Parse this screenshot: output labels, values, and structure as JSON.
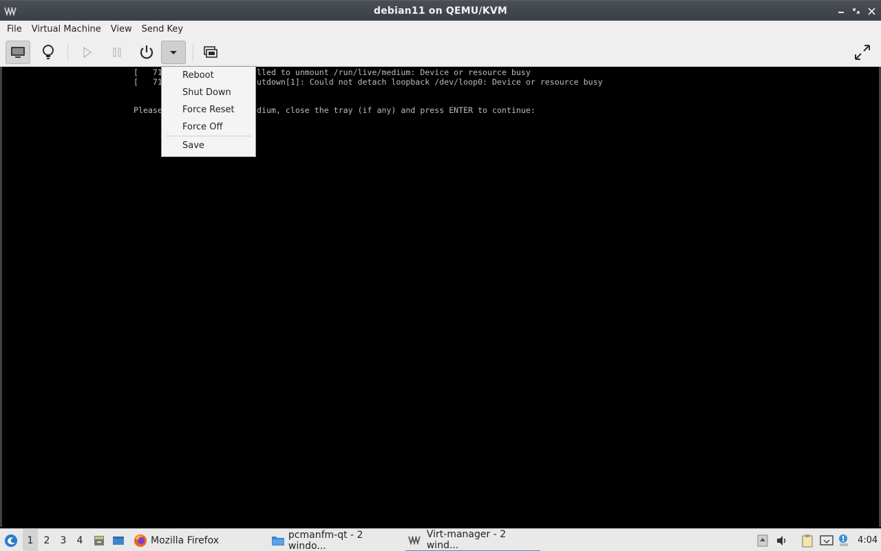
{
  "window": {
    "title": "debian11 on QEMU/KVM",
    "controls": [
      "minimize",
      "restore",
      "close"
    ]
  },
  "menubar": {
    "items": [
      "File",
      "Virtual Machine",
      "View",
      "Send Key"
    ]
  },
  "toolbar": {
    "buttons": [
      "console-view",
      "details-view",
      "run",
      "pause",
      "shutdown",
      "shutdown-menu",
      "snapshots",
      "fullscreen"
    ]
  },
  "console": {
    "lines": [
      "[   71",
      "[   71",
      "Please",
      "lled to unmount /run/live/medium: Device or resource busy",
      "utdown[1]: Could not detach loopback /dev/loop0: Device or resource busy",
      "dium, close the tray (if any) and press ENTER to continue:"
    ]
  },
  "shutdown_menu": {
    "items": [
      "Reboot",
      "Shut Down",
      "Force Reset",
      "Force Off",
      "Save"
    ]
  },
  "taskbar": {
    "desktops": [
      "1",
      "2",
      "3",
      "4"
    ],
    "current_desktop": "1",
    "tasks": [
      {
        "label": "Mozilla Firefox"
      },
      {
        "label": "pcmanfm-qt - 2 windo..."
      },
      {
        "label": "Virt-manager - 2 wind..."
      }
    ],
    "clock": "4:04"
  },
  "colors": {
    "titlebar": "#3f444a",
    "accent": "#3b8ed6",
    "console_bg": "#000000",
    "console_text": "#bdbdbd"
  }
}
